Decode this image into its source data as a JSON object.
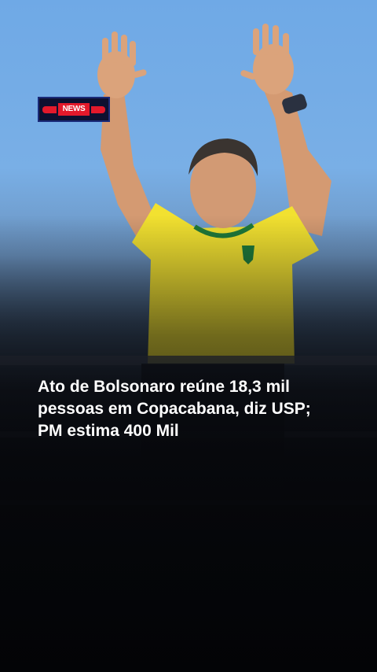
{
  "logo": {
    "text": "NEWS",
    "colors": {
      "red": "#e3192b",
      "navy": "#1a2a78"
    }
  },
  "headline": "Ato de Bolsonaro reúne 18,3 mil pessoas em Copacabana, diz USP; PM estima 400 Mil",
  "colors": {
    "sky": "#79afe6",
    "shirt": "#f2e130",
    "background": "#0b0d12"
  }
}
